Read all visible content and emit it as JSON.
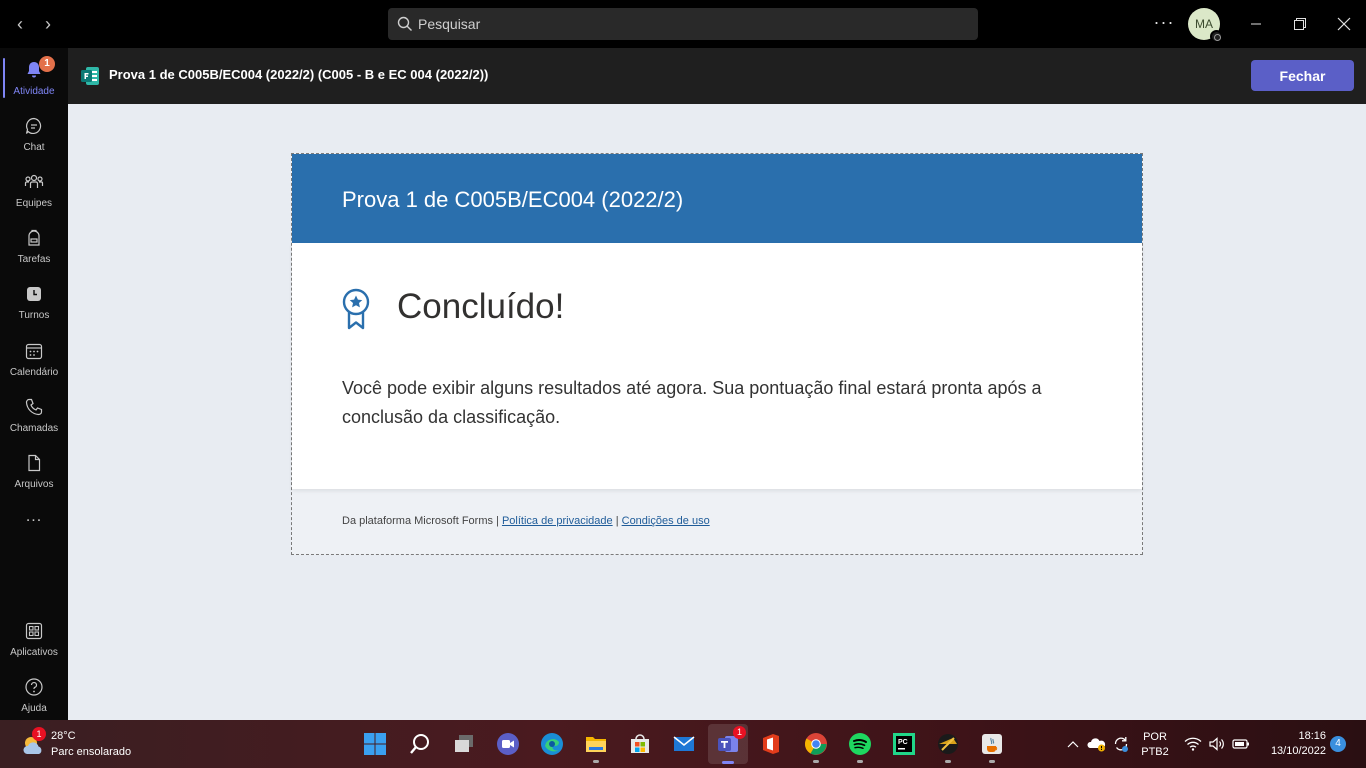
{
  "titlebar": {
    "search_placeholder": "Pesquisar",
    "avatar_initials": "MA"
  },
  "rail": {
    "items": [
      {
        "label": "Atividade",
        "badge": "1"
      },
      {
        "label": "Chat"
      },
      {
        "label": "Equipes"
      },
      {
        "label": "Tarefas"
      },
      {
        "label": "Turnos"
      },
      {
        "label": "Calendário"
      },
      {
        "label": "Chamadas"
      },
      {
        "label": "Arquivos"
      },
      {
        "label": "..."
      },
      {
        "label": "Aplicativos"
      },
      {
        "label": "Ajuda"
      }
    ]
  },
  "appbar": {
    "title": "Prova 1 de C005B/EC004 (2022/2) (C005 - B e EC 004 (2022/2))",
    "close_label": "Fechar"
  },
  "form": {
    "header_title": "Prova 1 de C005B/EC004 (2022/2)",
    "done_title": "Concluído!",
    "done_text": "Você pode exibir alguns resultados até agora. Sua pontuação final estará pronta após a conclusão da classificação.",
    "footer_prefix": "Da plataforma Microsoft Forms | ",
    "privacy_link": "Política de privacidade",
    "footer_sep": " | ",
    "terms_link": "Condições de uso",
    "accent_color": "#2a6fad"
  },
  "taskbar": {
    "weather_badge": "1",
    "weather_temp": "28°C",
    "weather_desc": "Parc ensolarado",
    "teams_badge": "1",
    "lang_line1": "POR",
    "lang_line2": "PTB2",
    "time": "18:16",
    "date": "13/10/2022",
    "notification_count": "4",
    "icons": [
      "windows-start-icon",
      "search-icon",
      "task-view-icon",
      "meet-icon",
      "edge-icon",
      "file-explorer-icon",
      "store-icon",
      "mail-icon",
      "teams-icon",
      "office-icon",
      "chrome-icon",
      "spotify-icon",
      "pycharm-icon",
      "app-icon",
      "java-icon"
    ]
  }
}
